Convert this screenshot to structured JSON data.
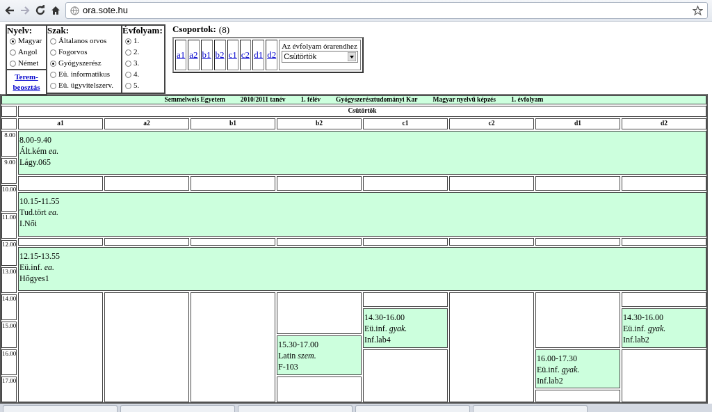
{
  "browser": {
    "address": "ora.sote.hu"
  },
  "filters": {
    "nyelv": {
      "title": "Nyelv:",
      "options": [
        {
          "label": "Magyar",
          "selected": true
        },
        {
          "label": "Angol",
          "selected": false
        },
        {
          "label": "Német",
          "selected": false
        }
      ],
      "link": "Terem-beosztás"
    },
    "szak": {
      "title": "Szak:",
      "options": [
        {
          "label": "Általanos orvos",
          "selected": false
        },
        {
          "label": "Fogorvos",
          "selected": false
        },
        {
          "label": "Gyógyszerész",
          "selected": true
        },
        {
          "label": "Eü. informatikus",
          "selected": false
        },
        {
          "label": "Eü. ügyvitelszerv.",
          "selected": false
        }
      ]
    },
    "evfolyam": {
      "title": "Évfolyam:",
      "options": [
        {
          "label": "1.",
          "selected": true
        },
        {
          "label": "2.",
          "selected": false
        },
        {
          "label": "3.",
          "selected": false
        },
        {
          "label": "4.",
          "selected": false
        },
        {
          "label": "5.",
          "selected": false
        }
      ]
    },
    "csoportok": {
      "title": "Csoportok:",
      "count": "(8)",
      "links": [
        "a1",
        "a2",
        "b1",
        "b2",
        "c1",
        "c2",
        "d1",
        "d2"
      ],
      "day_select": {
        "label": "Az évfolyam órarendhez",
        "value": "Csütörtök"
      }
    }
  },
  "timetable": {
    "header": [
      "Semmelweis Egyetem",
      "2010/2011 tanév",
      "1. félév",
      "Gyógyszerésztudományi Kar",
      "Magyar nyelvű képzés",
      "1. évfolyam"
    ],
    "day": "Csütörtök",
    "hours": [
      "8.00",
      "9.00",
      "10.00",
      "11.00",
      "12.00",
      "13.00",
      "14.00",
      "15.00",
      "16.00",
      "17.00"
    ],
    "common_events": [
      {
        "time": "8.00-9.40",
        "subject": "Ált.kém *ea.*",
        "room": "Lágy.065"
      },
      {
        "time": "10.15-11.55",
        "subject": "Tud.tört *ea.*",
        "room": "I.Női"
      },
      {
        "time": "12.15-13.55",
        "subject": "Eü.inf. *ea.*",
        "room": "Hőgyes1"
      }
    ],
    "columns": [
      {
        "label": "a1"
      },
      {
        "label": "a2"
      },
      {
        "label": "b1"
      },
      {
        "label": "b2",
        "events": [
          {
            "time": "15.30-17.00",
            "subject": "Latin *szem.*",
            "room": "F-103"
          }
        ]
      },
      {
        "label": "c1",
        "events": [
          {
            "time": "14.30-16.00",
            "subject": "Eü.inf. *gyak.*",
            "room": "Inf.lab4"
          }
        ]
      },
      {
        "label": "c2"
      },
      {
        "label": "d1",
        "events": [
          {
            "time": "16.00-17.30",
            "subject": "Eü.inf. *gyak.*",
            "room": "Inf.lab2"
          }
        ]
      },
      {
        "label": "d2",
        "events": [
          {
            "time": "14.30-16.00",
            "subject": "Eü.inf. *gyak.*",
            "room": "Inf.lab2"
          }
        ]
      }
    ]
  }
}
